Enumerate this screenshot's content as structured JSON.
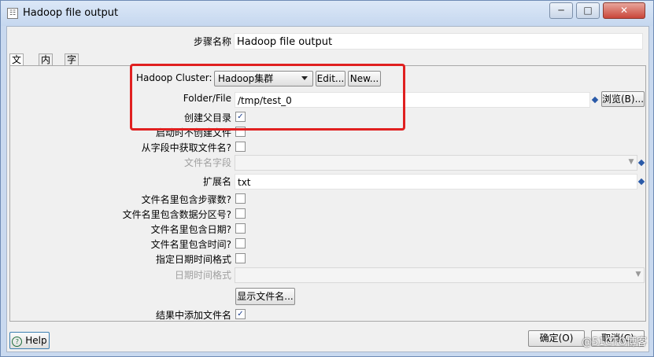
{
  "window": {
    "title": "Hadoop file output",
    "minimize": "─",
    "maximize": "□",
    "close": "✕"
  },
  "step_name": {
    "label": "步骤名称",
    "value": "Hadoop file output"
  },
  "tabs": [
    {
      "label": "文件"
    },
    {
      "label": "内容"
    },
    {
      "label": "字段"
    }
  ],
  "file_tab": {
    "hadoop_cluster": {
      "label": "Hadoop Cluster:",
      "value": "Hadoop集群",
      "edit": "Edit...",
      "new": "New..."
    },
    "folder_file": {
      "label": "Folder/File",
      "value": "/tmp/test_0",
      "browse": "浏览(B)..."
    },
    "create_parent_dir": {
      "label": "创建父目录",
      "checked": "✓"
    },
    "no_create_on_start": {
      "label": "启动时不创建文件"
    },
    "filename_from_field": {
      "label": "从字段中获取文件名?"
    },
    "filename_field": {
      "label": "文件名字段",
      "value": ""
    },
    "extension": {
      "label": "扩展名",
      "value": "txt"
    },
    "include_stepnr": {
      "label": "文件名里包含步骤数?"
    },
    "include_partition": {
      "label": "文件名里包含数据分区号?"
    },
    "include_date": {
      "label": "文件名里包含日期?"
    },
    "include_time": {
      "label": "文件名里包含时间?"
    },
    "specify_date_format": {
      "label": "指定日期时间格式"
    },
    "date_time_format": {
      "label": "日期时间格式",
      "value": ""
    },
    "show_filenames": {
      "label": "显示文件名..."
    },
    "add_to_result": {
      "label": "结果中添加文件名",
      "checked": "✓"
    }
  },
  "footer": {
    "help": "Help",
    "ok": "确定(O)",
    "cancel": "取消(C)"
  },
  "watermark": "@51CTO博客"
}
